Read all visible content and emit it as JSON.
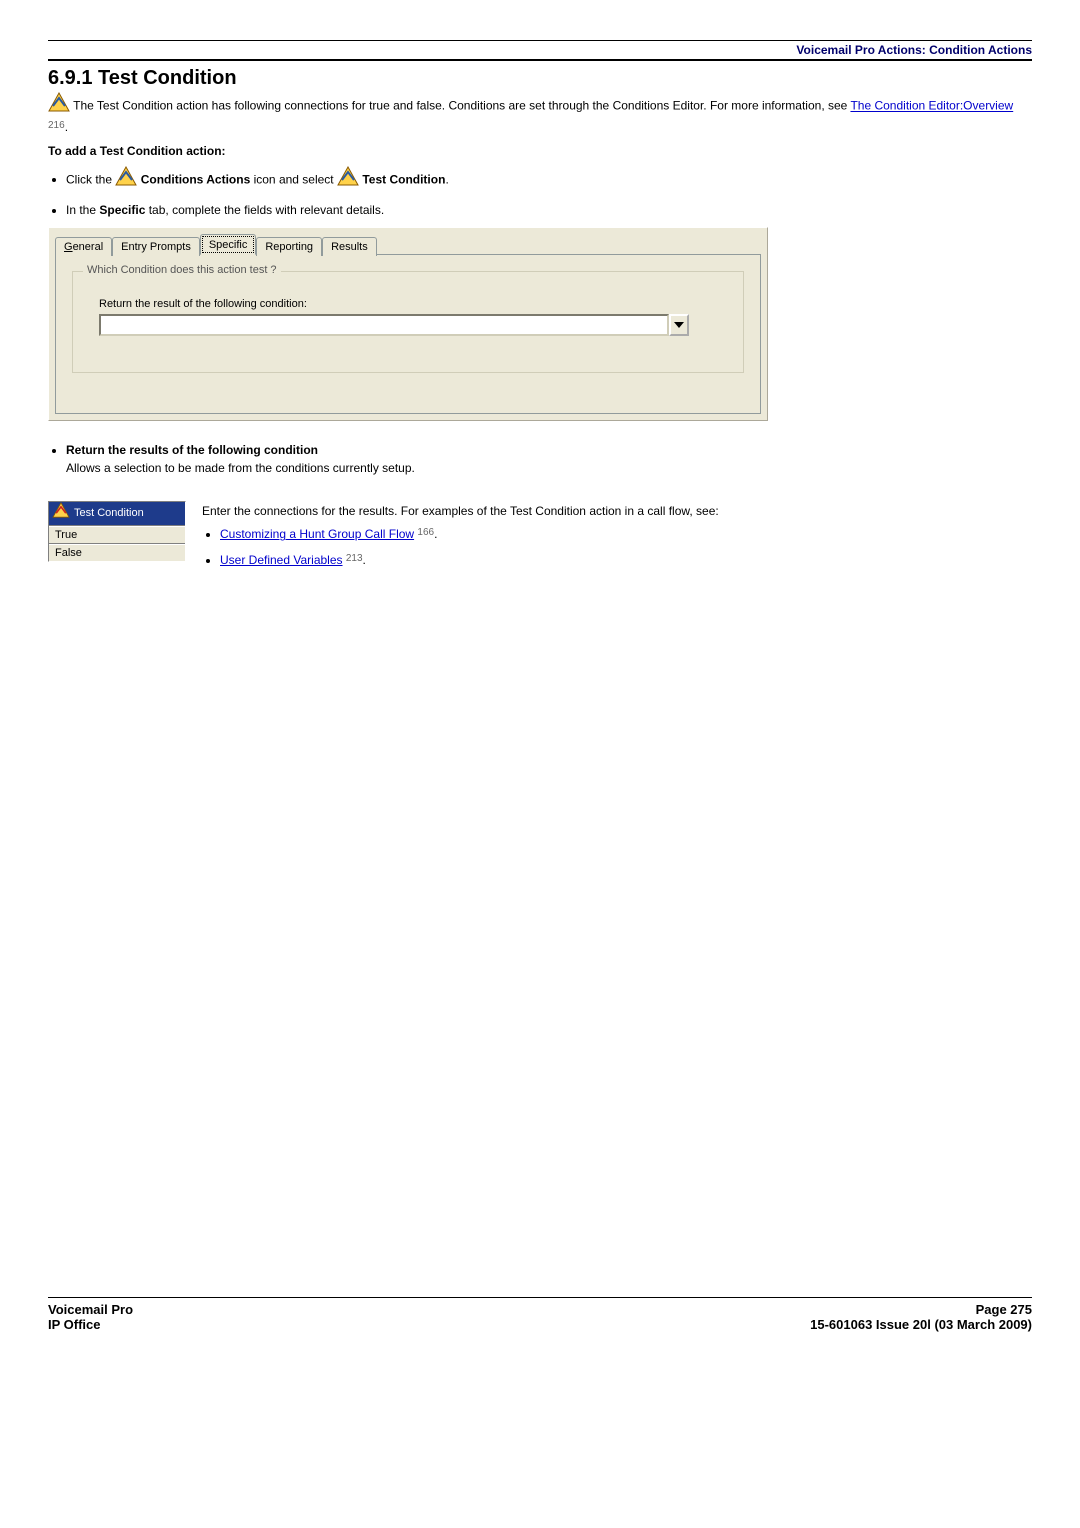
{
  "header": {
    "breadcrumb": "Voicemail Pro Actions: Condition Actions"
  },
  "section": {
    "number_title": "6.9.1 Test Condition",
    "intro_pre": " The Test Condition action has following connections for true and false. Conditions are set through the Conditions Editor. For more information, see ",
    "intro_link": "The Condition Editor:Overview",
    "intro_ref": "216",
    "intro_post": ".",
    "subheading": "To add a Test Condition action:",
    "bullet1_pre": "Click the ",
    "bullet1_bold1": "Conditions Actions",
    "bullet1_mid": " icon and select ",
    "bullet1_bold2": "Test Condition",
    "bullet1_post": ".",
    "bullet2_pre": "In the ",
    "bullet2_bold": "Specific",
    "bullet2_post": " tab, complete the fields with relevant details."
  },
  "tabs": {
    "general": "General",
    "entry": "Entry Prompts",
    "specific": "Specific",
    "reporting": "Reporting",
    "results": "Results",
    "group_title": "Which Condition does this action test ?",
    "field_label": "Return the result of the following condition:"
  },
  "result_bullet": {
    "title": "Return the results of the following condition",
    "desc": "Allows a selection to be made from the conditions currently setup."
  },
  "connections": {
    "header": "Test Condition",
    "row_true": "True",
    "row_false": "False",
    "text": "Enter the connections for the results. For examples of the Test Condition action in a call flow, see:",
    "link1": "Customizing a Hunt Group Call Flow",
    "ref1": "166",
    "link2": "User Defined Variables",
    "ref2": "213"
  },
  "footer": {
    "left1": "Voicemail Pro",
    "left2": "IP Office",
    "right1": "Page 275",
    "right2": "15-601063 Issue 20l (03 March 2009)"
  }
}
